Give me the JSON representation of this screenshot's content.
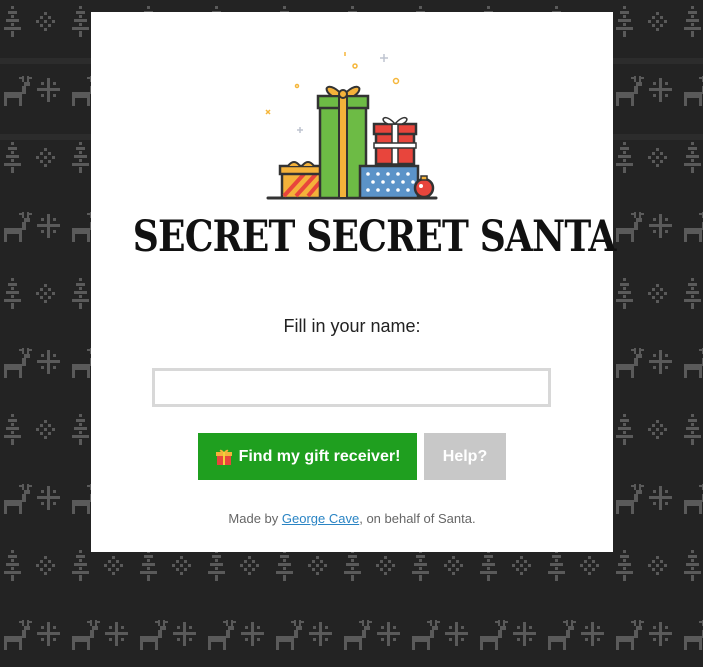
{
  "page": {
    "title": "SECRET SECRET SANTA",
    "prompt": "Fill in your name:"
  },
  "name_input": {
    "value": "",
    "placeholder": ""
  },
  "actions": {
    "find_label": "Find my gift receiver!",
    "help_label": "Help?"
  },
  "footer": {
    "made_by": "Made by ",
    "author": "George Cave",
    "suffix": ", on behalf of Santa."
  },
  "colors": {
    "background": "#232323",
    "pattern": "#555555",
    "card": "#ffffff",
    "find_button": "#1f9f1f",
    "help_button": "#c8c8c8",
    "link": "#2a84c4"
  },
  "icons": {
    "hero": "gift-boxes-illustration",
    "button": "gift-icon",
    "background": "ugly-sweater-pattern"
  }
}
